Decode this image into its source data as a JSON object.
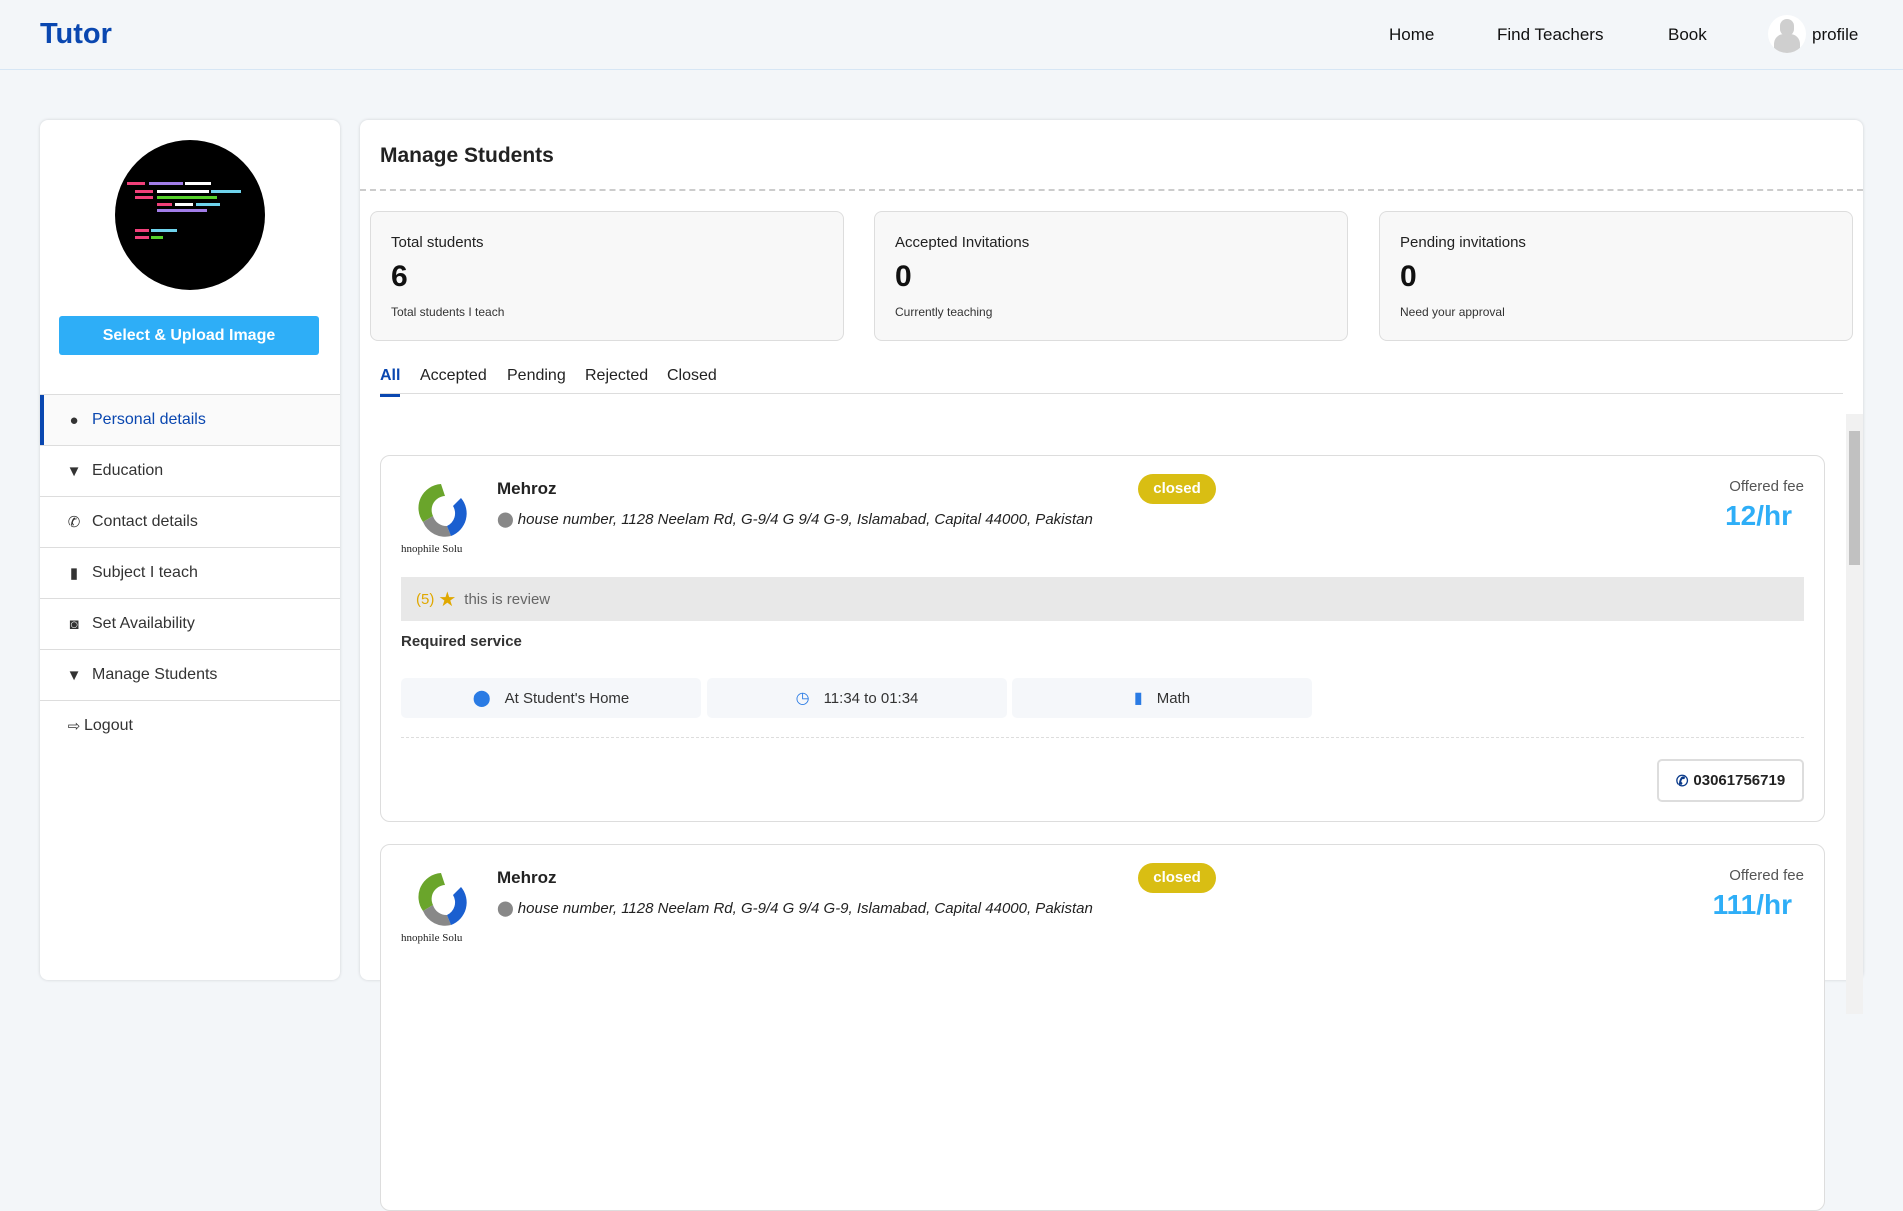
{
  "header": {
    "logo": "Tutor",
    "nav": [
      "Home",
      "Find Teachers",
      "Book"
    ],
    "profile": "profile"
  },
  "sidebar": {
    "upload_label": "Select & Upload Image",
    "items": [
      {
        "label": "Personal details",
        "icon": "user-icon",
        "active": true
      },
      {
        "label": "Education",
        "icon": "graduate-icon"
      },
      {
        "label": "Contact details",
        "icon": "phone-icon"
      },
      {
        "label": "Subject I teach",
        "icon": "book-icon"
      },
      {
        "label": "Set Availability",
        "icon": "briefcase-clock-icon"
      },
      {
        "label": "Manage Students",
        "icon": "graduate-icon"
      },
      {
        "label": "Logout",
        "icon": "logout-icon"
      }
    ]
  },
  "main": {
    "title": "Manage Students",
    "stats": [
      {
        "label": "Total students",
        "value": "6",
        "sub": "Total students I teach"
      },
      {
        "label": "Accepted Invitations",
        "value": "0",
        "sub": "Currently teaching"
      },
      {
        "label": "Pending invitations",
        "value": "0",
        "sub": "Need your approval"
      }
    ],
    "tabs": [
      "All",
      "Accepted",
      "Pending",
      "Rejected",
      "Closed"
    ],
    "active_tab": "All",
    "students": [
      {
        "name": "Mehroz",
        "address": "house number, 1128 Neelam Rd, G-9/4 G 9/4 G-9, Islamabad, Capital 44000, Pakistan",
        "status": "closed",
        "fee_label": "Offered fee",
        "fee": "12/hr",
        "rating": "(5)",
        "review": "this is review",
        "required_label": "Required service",
        "location": "At Student's Home",
        "time": "11:34 to 01:34",
        "subject": "Math",
        "phone": "03061756719",
        "logo_text": "hnophile Solu"
      },
      {
        "name": "Mehroz",
        "address": "house number, 1128 Neelam Rd, G-9/4 G 9/4 G-9, Islamabad, Capital 44000, Pakistan",
        "status": "closed",
        "fee_label": "Offered fee",
        "fee": "111/hr",
        "logo_text": "hnophile Solu"
      }
    ]
  },
  "colors": {
    "brand": "#0a47b0",
    "accent": "#2eaef7",
    "badge": "#d9be13"
  }
}
